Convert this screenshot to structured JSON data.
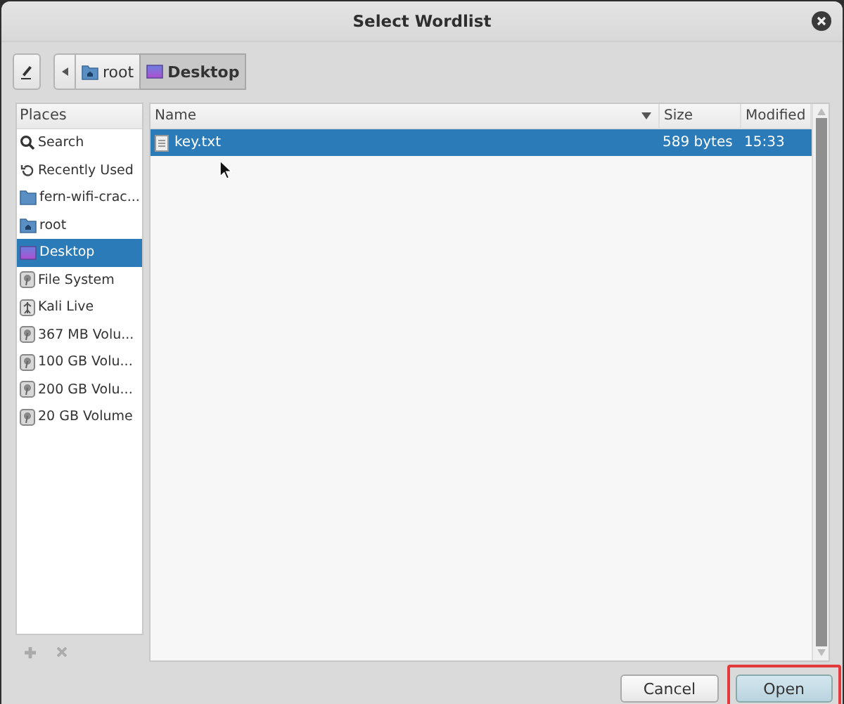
{
  "window": {
    "title": "Select Wordlist"
  },
  "path_bar": [
    {
      "label": "root",
      "kind": "home",
      "selected": false
    },
    {
      "label": "Desktop",
      "kind": "desktop",
      "selected": true
    }
  ],
  "places": {
    "title": "Places",
    "items": [
      {
        "label": "Search",
        "kind": "search",
        "selected": false
      },
      {
        "label": "Recently Used",
        "kind": "recent",
        "selected": false
      },
      {
        "label": "fern-wifi-crac...",
        "kind": "folder",
        "selected": false
      },
      {
        "label": "root",
        "kind": "home",
        "selected": false
      },
      {
        "label": "Desktop",
        "kind": "desktop",
        "selected": true
      },
      {
        "label": "File System",
        "kind": "drive",
        "selected": false
      },
      {
        "label": "Kali Live",
        "kind": "usb",
        "selected": false
      },
      {
        "label": "367 MB Volu...",
        "kind": "drive",
        "selected": false
      },
      {
        "label": "100 GB Volu...",
        "kind": "drive",
        "selected": false
      },
      {
        "label": "200 GB Volu...",
        "kind": "drive",
        "selected": false
      },
      {
        "label": "20 GB Volume",
        "kind": "drive",
        "selected": false
      }
    ]
  },
  "files": {
    "columns": [
      {
        "label": "Name",
        "sorted": true
      },
      {
        "label": "Size"
      },
      {
        "label": "Modified"
      }
    ],
    "rows": [
      {
        "name": "key.txt",
        "size": "589 bytes",
        "modified": "15:33",
        "selected": true
      }
    ]
  },
  "buttons": [
    {
      "label": "Cancel",
      "highlighted": false
    },
    {
      "label": "Open",
      "highlighted": true
    }
  ]
}
